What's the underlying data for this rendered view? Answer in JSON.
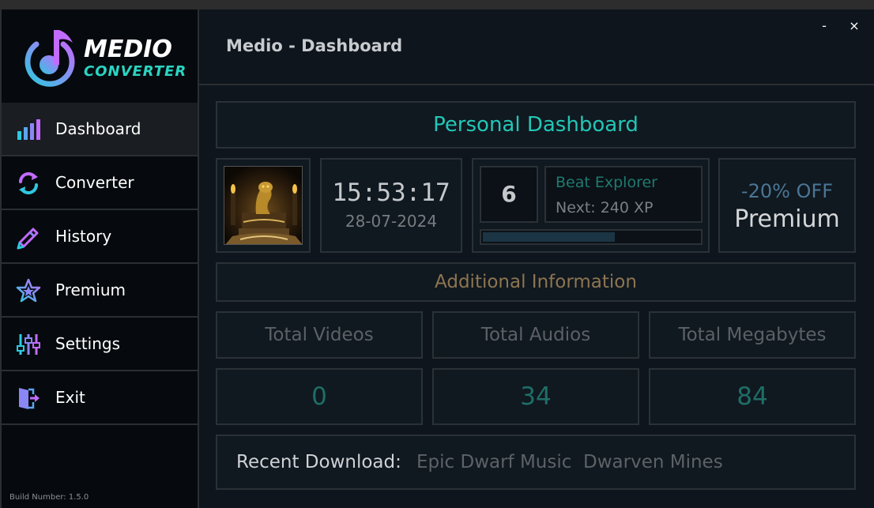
{
  "app": {
    "logo_line1": "MEDIO",
    "logo_line2": "CONVERTER",
    "title": "Medio - Dashboard",
    "minimize": "-",
    "close": "×",
    "build": "Build Number: 1.5.0"
  },
  "sidebar": {
    "items": [
      {
        "label": "Dashboard",
        "icon": "bar-chart-icon"
      },
      {
        "label": "Converter",
        "icon": "refresh-icon"
      },
      {
        "label": "History",
        "icon": "pencil-icon"
      },
      {
        "label": "Premium",
        "icon": "star-icon"
      },
      {
        "label": "Settings",
        "icon": "sliders-icon"
      },
      {
        "label": "Exit",
        "icon": "exit-door-icon"
      }
    ]
  },
  "dashboard": {
    "title": "Personal Dashboard",
    "time": "15:53:17",
    "date": "28-07-2024",
    "level": "6",
    "rank_name": "Beat Explorer",
    "next_xp": "Next: 240 XP",
    "xp_progress": 0.61,
    "promo_discount": "-20% OFF",
    "promo_label": "Premium",
    "additional_title": "Additional Information",
    "stats": [
      {
        "label": "Total Videos",
        "value": "0"
      },
      {
        "label": "Total Audios",
        "value": "34"
      },
      {
        "label": "Total Megabytes",
        "value": "84"
      }
    ],
    "recent_label": "Recent Download:",
    "recent_value": "Epic Dwarf Music  Dwarven Mines"
  },
  "colors": {
    "accent_teal": "#22c7b6",
    "background": "#0e151c",
    "sidebar": "#060a0e"
  }
}
